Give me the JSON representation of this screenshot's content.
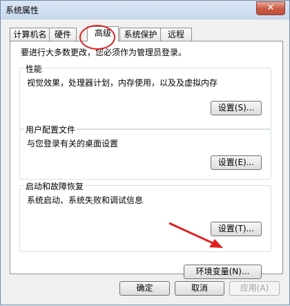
{
  "window": {
    "title": "系统属性",
    "close_glyph": "✕"
  },
  "tabs": [
    {
      "label": "计算机名"
    },
    {
      "label": "硬件"
    },
    {
      "label": "高级"
    },
    {
      "label": "系统保护"
    },
    {
      "label": "远程"
    }
  ],
  "active_tab": "高级",
  "panel": {
    "intro": "要进行大多数更改，您必须作为管理员登录。",
    "performance": {
      "title": "性能",
      "desc": "视觉效果，处理器计划，内存使用，以及及虚拟内存",
      "button": "设置(S)..."
    },
    "user_profiles": {
      "title": "用户配置文件",
      "desc": "与您登录有关的桌面设置",
      "button": "设置(E)..."
    },
    "startup": {
      "title": "启动和故障恢复",
      "desc": "系统启动、系统失败和调试信息",
      "button": "设置(T)..."
    },
    "env_button": "环境变量(N)..."
  },
  "footer": {
    "ok": "确定",
    "cancel": "取消",
    "apply": "应用(A)"
  },
  "annotation_color": "#e02020"
}
